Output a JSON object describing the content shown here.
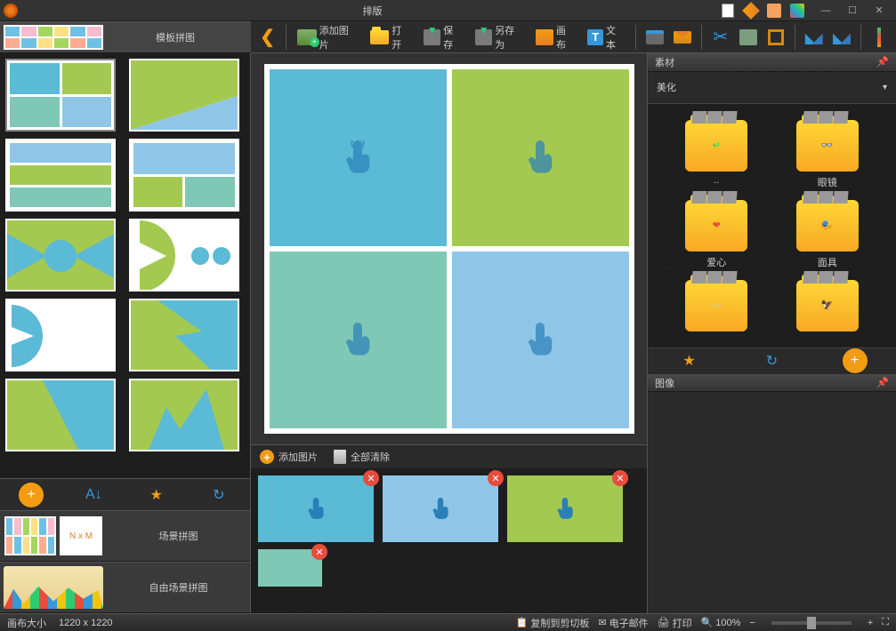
{
  "app": {
    "title": "排版"
  },
  "winbtns": {
    "min": "—",
    "max": "☐",
    "close": "✕"
  },
  "toolbar": {
    "back": "❮",
    "add_image": "添加图片",
    "open": "打开",
    "save": "保存",
    "save_as": "另存为",
    "canvas": "画布",
    "text": "文本"
  },
  "left": {
    "template_collage": "模板拼图",
    "scene_collage": "场景拼图",
    "free_scene_collage": "自由场景拼图",
    "nxm": "N x M"
  },
  "tray": {
    "add_image": "添加图片",
    "clear_all": "全部清除"
  },
  "right": {
    "panel_sucai": "素材",
    "panel_image": "图像",
    "category": "美化",
    "folders": {
      "back": "..",
      "glasses": "眼镜",
      "love": "爱心",
      "mask": "面具"
    }
  },
  "statusbar": {
    "canvas_size_label": "画布大小",
    "canvas_size": "1220 x 1220",
    "copy_clipboard": "复制到剪切板",
    "email": "电子邮件",
    "print": "打印",
    "zoom": "100%",
    "minus": "−",
    "plus": "+"
  }
}
